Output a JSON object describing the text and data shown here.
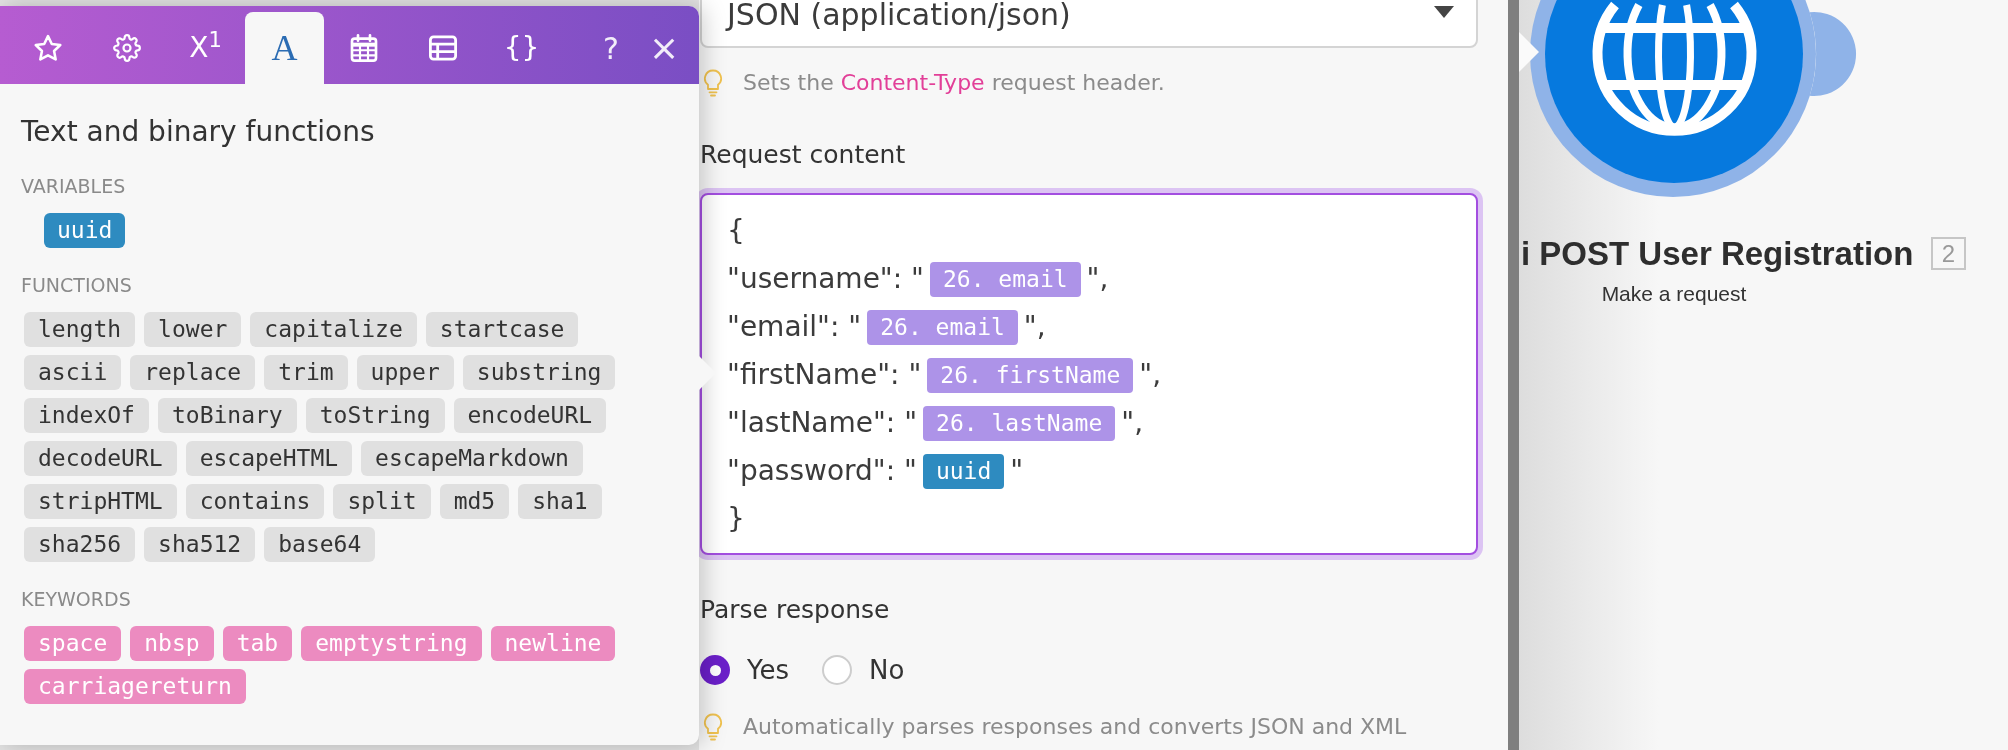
{
  "function_popover": {
    "tabs": [
      {
        "kind": "icon",
        "selected": false
      },
      {
        "kind": "icon",
        "selected": false
      },
      {
        "kind": "symbol",
        "label": "X$^{1}$",
        "selected": false
      },
      {
        "kind": "letter",
        "label": "A",
        "selected": true
      },
      {
        "kind": "icon",
        "selected": false
      },
      {
        "kind": "icon",
        "selected": false
      },
      {
        "kind": "symbol",
        "label": "{}",
        "selected": false
      }
    ],
    "help_button": "?",
    "close_button": "×",
    "title": "Text and binary functions",
    "sections": [
      {
        "kind": "variables",
        "heading": "VARIABLES",
        "items": [
          "uuid"
        ]
      },
      {
        "kind": "functions",
        "heading": "FUNCTIONS",
        "items": [
          "length",
          "lower",
          "capitalize",
          "startcase",
          "ascii",
          "replace",
          "trim",
          "upper",
          "substring",
          "indexOf",
          "toBinary",
          "toString",
          "encodeURL",
          "decodeURL",
          "escapeHTML",
          "escapeMarkdown",
          "stripHTML",
          "contains",
          "split",
          "md5",
          "sha1",
          "sha256",
          "sha512",
          "base64"
        ]
      },
      {
        "kind": "keywords",
        "heading": "KEYWORDS",
        "items": [
          "space",
          "nbsp",
          "tab",
          "emptystring",
          "newline",
          "carriagereturn"
        ]
      }
    ]
  },
  "content_type": {
    "value": "JSON (application/json)",
    "hint": [
      {
        "text": "Sets the ",
        "highlight": false
      },
      {
        "text": "Content-Type",
        "highlight": true
      },
      {
        "text": " request header.",
        "highlight": false
      }
    ]
  },
  "request_content": {
    "label": "Request content",
    "lines": [
      {
        "segments": [
          {
            "kind": "text",
            "text": "{"
          }
        ]
      },
      {
        "segments": [
          {
            "kind": "text",
            "text": "\"username\": \""
          },
          {
            "kind": "mapped",
            "text": "26. email"
          },
          {
            "kind": "text",
            "text": "\","
          }
        ]
      },
      {
        "segments": [
          {
            "kind": "text",
            "text": "\"email\": \""
          },
          {
            "kind": "mapped",
            "text": "26. email"
          },
          {
            "kind": "text",
            "text": "\","
          }
        ]
      },
      {
        "segments": [
          {
            "kind": "text",
            "text": "\"firstName\": \""
          },
          {
            "kind": "mapped",
            "text": "26. firstName"
          },
          {
            "kind": "text",
            "text": "\","
          }
        ]
      },
      {
        "segments": [
          {
            "kind": "text",
            "text": "\"lastName\": \""
          },
          {
            "kind": "mapped",
            "text": "26. lastName"
          },
          {
            "kind": "text",
            "text": "\","
          }
        ]
      },
      {
        "segments": [
          {
            "kind": "text",
            "text": "\"password\": \""
          },
          {
            "kind": "function",
            "text": "uuid"
          },
          {
            "kind": "text",
            "text": "\""
          }
        ]
      },
      {
        "segments": [
          {
            "kind": "text",
            "text": "}"
          }
        ]
      }
    ]
  },
  "parse_response": {
    "label": "Parse response",
    "options": [
      {
        "label": "Yes",
        "selected": true
      },
      {
        "label": "No",
        "selected": false
      }
    ],
    "hint": "Automatically parses responses and converts JSON and XML"
  },
  "module": {
    "title": "i POST User Registration",
    "badge": "2",
    "subtitle": "Make a request"
  }
}
